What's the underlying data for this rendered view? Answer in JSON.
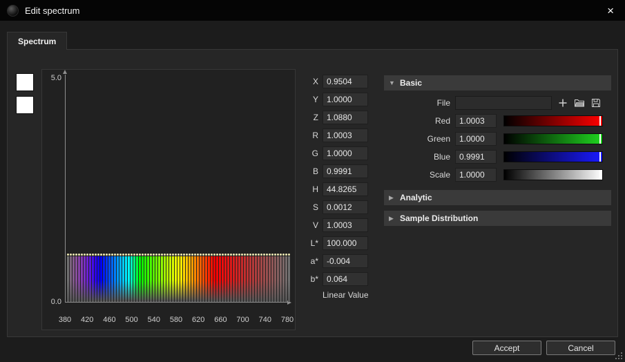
{
  "window": {
    "title": "Edit spectrum",
    "close": "×"
  },
  "tab": {
    "label": "Spectrum"
  },
  "swatches": [
    "#ffffff",
    "#ffffff"
  ],
  "value_fields": {
    "groups": [
      [
        {
          "label": "X",
          "value": "0.9504"
        },
        {
          "label": "Y",
          "value": "1.0000"
        },
        {
          "label": "Z",
          "value": "1.0880"
        }
      ],
      [
        {
          "label": "R",
          "value": "1.0003"
        },
        {
          "label": "G",
          "value": "1.0000"
        },
        {
          "label": "B",
          "value": "0.9991"
        }
      ],
      [
        {
          "label": "H",
          "value": "44.8265"
        },
        {
          "label": "S",
          "value": "0.0012"
        },
        {
          "label": "V",
          "value": "1.0003"
        }
      ],
      [
        {
          "label": "L*",
          "value": "100.000"
        },
        {
          "label": "a*",
          "value": "-0.004"
        },
        {
          "label": "b*",
          "value": "0.064"
        }
      ]
    ],
    "footnote": "Linear Value"
  },
  "basic": {
    "title": "Basic",
    "file": {
      "label": "File",
      "value": ""
    },
    "icons": [
      {
        "name": "add-icon"
      },
      {
        "name": "open-folder-icon"
      },
      {
        "name": "save-icon"
      }
    ],
    "sliders": [
      {
        "label": "Red",
        "value": "1.0003",
        "color": "#ff0000"
      },
      {
        "label": "Green",
        "value": "1.0000",
        "color": "#1fd41f"
      },
      {
        "label": "Blue",
        "value": "0.9991",
        "color": "#1a1aff"
      },
      {
        "label": "Scale",
        "value": "1.0000",
        "color": "#ffffff"
      }
    ]
  },
  "sections": [
    {
      "title": "Analytic"
    },
    {
      "title": "Sample Distribution"
    }
  ],
  "buttons": {
    "accept": "Accept",
    "cancel": "Cancel"
  },
  "chart_data": {
    "type": "bar",
    "title": "",
    "xlabel": "",
    "ylabel": "",
    "xlim": [
      380,
      780
    ],
    "ylim": [
      0,
      5
    ],
    "grid": false,
    "x_ticks": [
      380,
      420,
      460,
      500,
      540,
      580,
      620,
      660,
      700,
      740,
      780
    ],
    "y_ticks": [
      "5.0",
      "0.0"
    ],
    "point_color": "#efe9b4",
    "x": [
      380,
      385,
      390,
      395,
      400,
      405,
      410,
      415,
      420,
      425,
      430,
      435,
      440,
      445,
      450,
      455,
      460,
      465,
      470,
      475,
      480,
      485,
      490,
      495,
      500,
      505,
      510,
      515,
      520,
      525,
      530,
      535,
      540,
      545,
      550,
      555,
      560,
      565,
      570,
      575,
      580,
      585,
      590,
      595,
      600,
      605,
      610,
      615,
      620,
      625,
      630,
      635,
      640,
      645,
      650,
      655,
      660,
      665,
      670,
      675,
      680,
      685,
      690,
      695,
      700,
      705,
      710,
      715,
      720,
      725,
      730,
      735,
      740,
      745,
      750,
      755,
      760,
      765,
      770,
      775,
      780
    ],
    "values": [
      1,
      1,
      1,
      1,
      1,
      1,
      1,
      1,
      1,
      1,
      1,
      1,
      1,
      1,
      1,
      1,
      1,
      1,
      1,
      1,
      1,
      1,
      1,
      1,
      1,
      1,
      1,
      1,
      1,
      1,
      1,
      1,
      1,
      1,
      1,
      1,
      1,
      1,
      1,
      1,
      1,
      1,
      1,
      1,
      1,
      1,
      1,
      1,
      1,
      1,
      1,
      1,
      1,
      1,
      1,
      1,
      1,
      1,
      1,
      1,
      1,
      1,
      1,
      1,
      1,
      1,
      1,
      1,
      1,
      1,
      1,
      1,
      1,
      1,
      1,
      1,
      1,
      1,
      1,
      1,
      1
    ]
  }
}
